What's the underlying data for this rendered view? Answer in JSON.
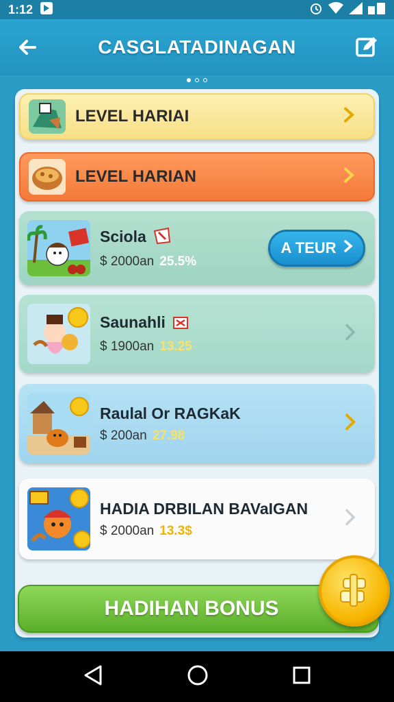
{
  "status_bar": {
    "time": "1:12"
  },
  "app_bar": {
    "title": "CASGLATADINAGAN"
  },
  "levels": [
    {
      "label": "LEVEL HARIAI"
    },
    {
      "label": "LEVEL HARIAN"
    }
  ],
  "items": [
    {
      "title": "Sciola",
      "price": "$ 2000an",
      "value": "25.5%",
      "value_color": "#ffffff",
      "action": "A TEUR"
    },
    {
      "title": "Saunahli",
      "price": "$ 1900an",
      "value": "13.25",
      "value_color": "#fbe26a"
    },
    {
      "title": "Raulal Or RAGKaK",
      "price": "$ 200an",
      "value": "27.98",
      "value_color": "#f6e36a"
    },
    {
      "title": "HADIA DRBILAN BAVaIGAN",
      "price": "$ 2000an",
      "value": "13.3$",
      "value_color": "#f0b400"
    }
  ],
  "bonus": {
    "label": "HADIHAN BONUS"
  },
  "icons": [
    "back-arrow-icon",
    "edit-icon",
    "chevron-right-icon",
    "coin-icon",
    "nav-back-icon",
    "nav-home-icon",
    "nav-recents-icon"
  ]
}
